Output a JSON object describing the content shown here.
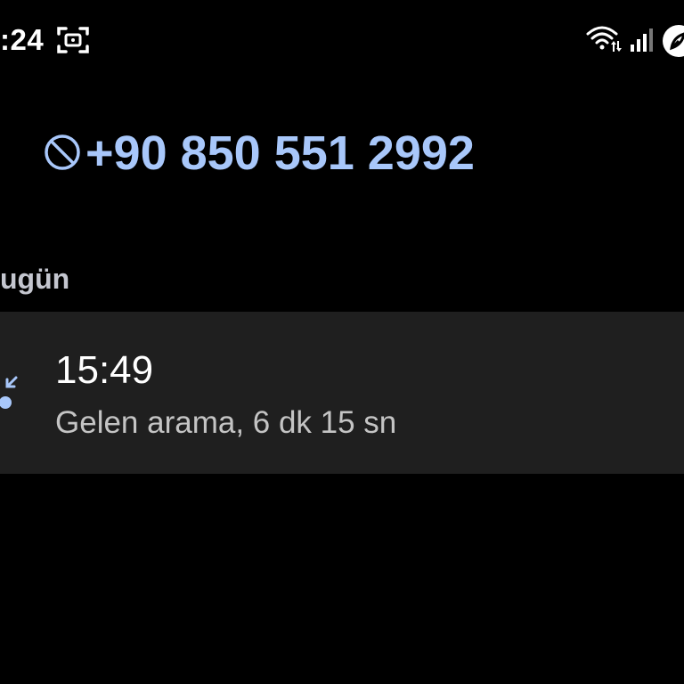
{
  "status_bar": {
    "time": ":24",
    "icons": [
      "screenshot-icon",
      "wifi-icon",
      "signal-icon",
      "app-icon"
    ]
  },
  "contact": {
    "number": "+90 850 551 2992",
    "status_icon": "blocked-icon"
  },
  "history": {
    "section_label": "ugün",
    "calls": [
      {
        "time": "15:49",
        "description": "Gelen arama, 6 dk 15 sn",
        "direction_icon": "incoming-call-icon"
      }
    ]
  },
  "colors": {
    "background": "#000000",
    "accent": "#a8c7fa",
    "card": "#1f1f1f",
    "secondary_text": "#c4c4c4"
  }
}
